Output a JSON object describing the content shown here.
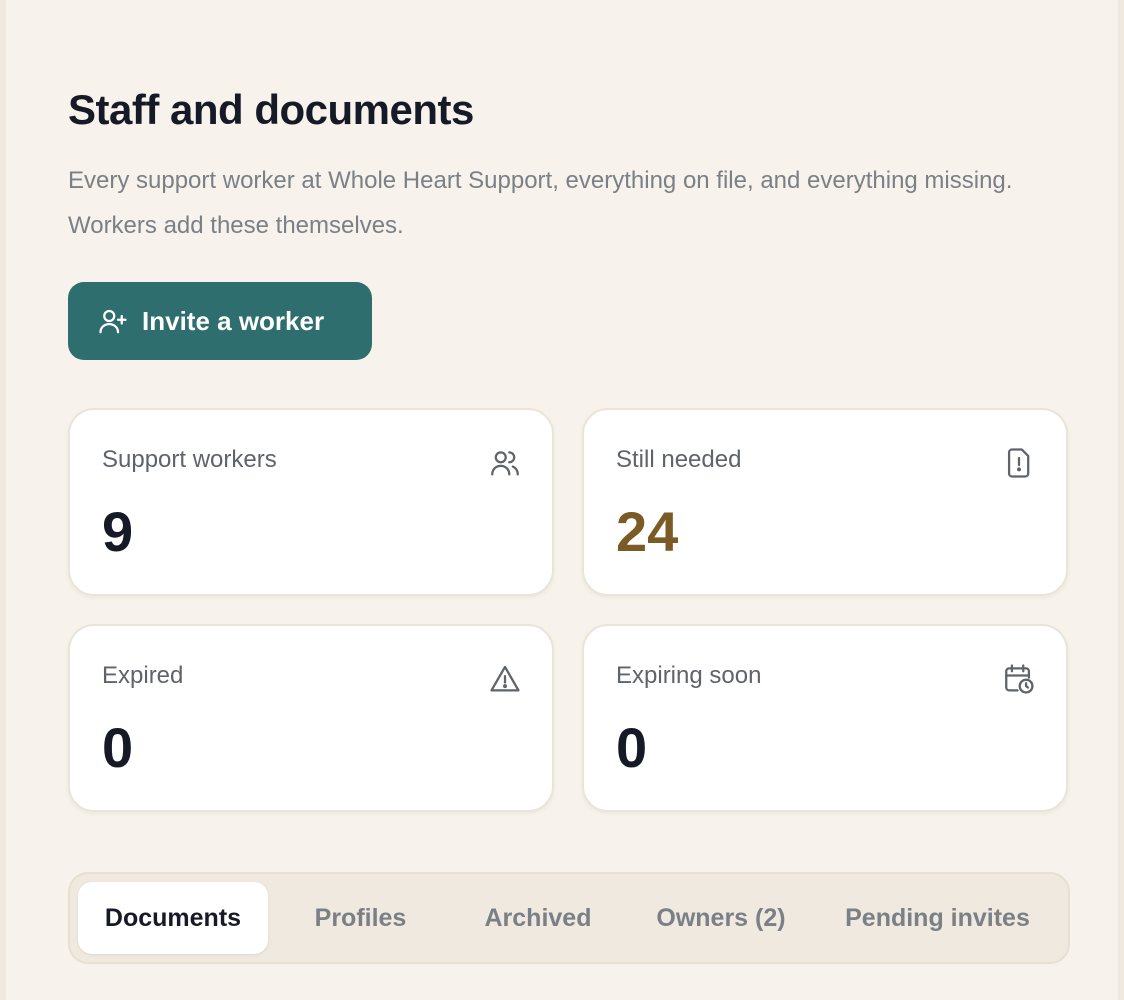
{
  "header": {
    "title": "Staff and documents",
    "subtitle": "Every support worker at Whole Heart Support, everything on file, and everything missing. Workers add these themselves."
  },
  "actions": {
    "invite_label": "Invite a worker",
    "invite_icon": "user-plus-icon"
  },
  "stats": [
    {
      "label": "Support workers",
      "value": "9",
      "icon": "users-icon"
    },
    {
      "label": "Still needed",
      "value": "24",
      "icon": "file-alert-icon",
      "value_color": "#7a5a25"
    },
    {
      "label": "Expired",
      "value": "0",
      "icon": "warning-triangle-icon"
    },
    {
      "label": "Expiring soon",
      "value": "0",
      "icon": "calendar-clock-icon"
    }
  ],
  "tabs": [
    {
      "label": "Documents",
      "active": true
    },
    {
      "label": "Profiles",
      "active": false
    },
    {
      "label": "Archived",
      "active": false
    },
    {
      "label": "Owners (2)",
      "active": false
    },
    {
      "label": "Pending invites",
      "active": false
    }
  ],
  "colors": {
    "background": "#f7f3ec",
    "primary": "#2f6e6e",
    "warning_text": "#7a5a25"
  }
}
